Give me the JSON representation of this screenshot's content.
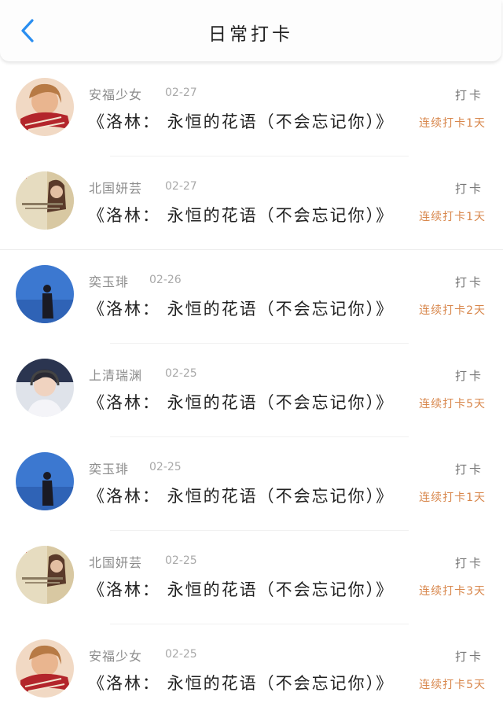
{
  "header": {
    "title": "日常打卡",
    "back_icon": "chevron-left-icon",
    "accent_color": "#2a8ef0"
  },
  "colors": {
    "streak": "#d8874c",
    "username": "#8b8b8b",
    "date": "#a9a9a9"
  },
  "entries": [
    {
      "user": "安福少女",
      "date": "02-27",
      "action": "打卡",
      "title": "《洛林： 永恒的花语（不会忘记你）》",
      "streak": "连续打卡1天",
      "avatar": "red-scarf"
    },
    {
      "user": "北国妍芸",
      "date": "02-27",
      "action": "打卡",
      "title": "《洛林： 永恒的花语（不会忘记你）》",
      "streak": "连续打卡1天",
      "avatar": "quote-card"
    },
    {
      "user": "奕玉琲",
      "date": "02-26",
      "action": "打卡",
      "title": "《洛林： 永恒的花语（不会忘记你）》",
      "streak": "连续打卡2天",
      "avatar": "blue-silhouette"
    },
    {
      "user": "上清瑞渊",
      "date": "02-25",
      "action": "打卡",
      "title": "《洛林： 永恒的花语（不会忘记你）》",
      "streak": "连续打卡5天",
      "avatar": "headphone-boy"
    },
    {
      "user": "奕玉琲",
      "date": "02-25",
      "action": "打卡",
      "title": "《洛林： 永恒的花语（不会忘记你）》",
      "streak": "连续打卡1天",
      "avatar": "blue-silhouette"
    },
    {
      "user": "北国妍芸",
      "date": "02-25",
      "action": "打卡",
      "title": "《洛林： 永恒的花语（不会忘记你）》",
      "streak": "连续打卡3天",
      "avatar": "quote-card"
    },
    {
      "user": "安福少女",
      "date": "02-25",
      "action": "打卡",
      "title": "《洛林： 永恒的花语（不会忘记你）》",
      "streak": "连续打卡5天",
      "avatar": "red-scarf"
    }
  ]
}
